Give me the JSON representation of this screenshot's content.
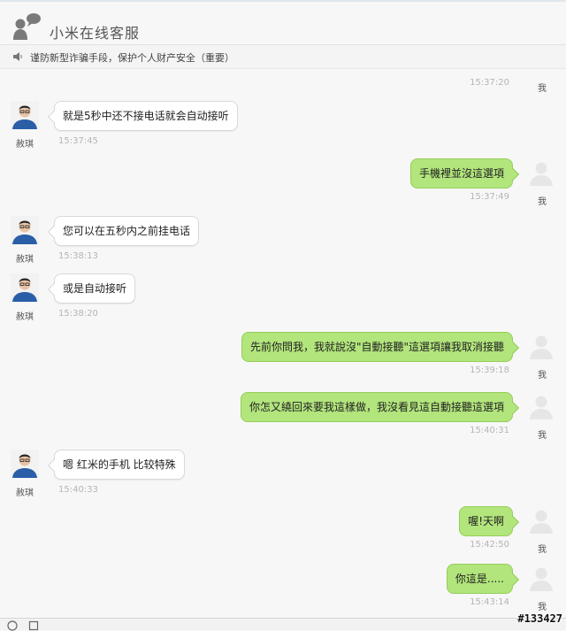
{
  "header": {
    "title": "小米在线客服"
  },
  "notice": {
    "text": "谨防新型诈骗手段，保护个人财产安全（重要）"
  },
  "top_stamp": {
    "time": "15:37:20",
    "me": "我"
  },
  "messages": [
    {
      "sender": "agent",
      "name": "赦琪",
      "text": "就是5秒中还不接电话就会自动接听",
      "time": "15:37:45"
    },
    {
      "sender": "me",
      "name": "我",
      "text": "手機裡並沒這選項",
      "time": "15:37:49"
    },
    {
      "sender": "agent",
      "name": "赦琪",
      "text": "您可以在五秒内之前挂电话",
      "time": "15:38:13"
    },
    {
      "sender": "agent",
      "name": "赦琪",
      "text": "或是自动接听",
      "time": "15:38:20"
    },
    {
      "sender": "me",
      "name": "我",
      "text": "先前你問我，我就說沒\"自動接聽\"這選項讓我取消接聽",
      "time": "15:39:18"
    },
    {
      "sender": "me",
      "name": "我",
      "text": "你怎又繞回來要我這樣做，我沒看見這自動接聽這選項",
      "time": "15:40:31"
    },
    {
      "sender": "agent",
      "name": "赦琪",
      "text": "嗯 红米的手机 比较特殊",
      "time": "15:40:33"
    },
    {
      "sender": "me",
      "name": "我",
      "text": "喔!天啊",
      "time": "15:42:50"
    },
    {
      "sender": "me",
      "name": "我",
      "text": "你這是.....",
      "time": "15:43:14"
    }
  ],
  "watermark": "#133427",
  "colors": {
    "my_bubble": "#b2e57c",
    "agent_bubble": "#ffffff",
    "agent_shirt": "#2a5fa8"
  }
}
